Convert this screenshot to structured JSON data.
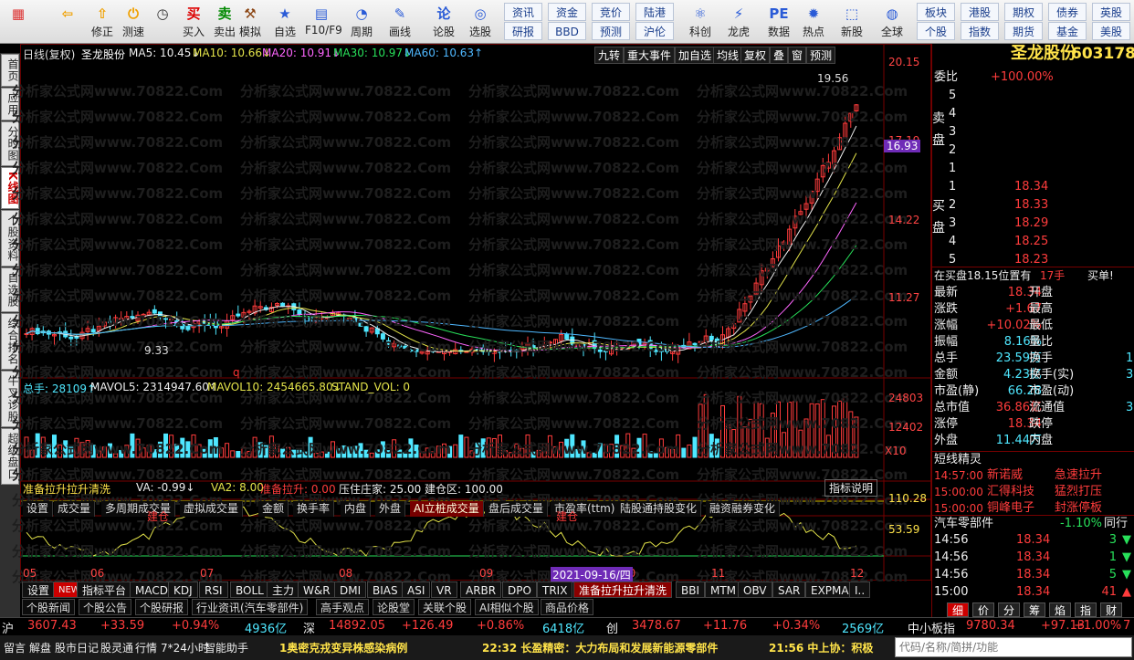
{
  "toolbar": {
    "buttons": [
      {
        "label": "",
        "icon": "apps-grid-icon",
        "c": "#d33"
      },
      {
        "label": "",
        "icon": "back-arrow-icon",
        "c": "#f0a000"
      },
      {
        "label": "修正",
        "icon": "arrow-up-icon",
        "c": "#f0a000"
      },
      {
        "label": "测速",
        "icon": "power-icon",
        "c": "#f0a000"
      },
      {
        "label": "",
        "icon": "clock-icon",
        "c": "#333"
      },
      {
        "label": "买入",
        "icon": "buy-icon",
        "c": "#d00"
      },
      {
        "label": "卖出",
        "icon": "sell-icon",
        "c": "#080"
      },
      {
        "label": "模拟",
        "icon": "hammer-icon",
        "c": "#8b4513"
      },
      {
        "label": "自选",
        "icon": "star-folder-icon",
        "c": "#2a5bd7"
      },
      {
        "label": "F10/F9",
        "icon": "f10-icon",
        "c": "#2a5bd7"
      },
      {
        "label": "周期",
        "icon": "cycle-icon",
        "c": "#2a5bd7"
      },
      {
        "label": "画线",
        "icon": "pencil-icon",
        "c": "#2a5bd7"
      },
      {
        "label": "论股",
        "icon": "discuss-icon",
        "c": "#2a5bd7"
      },
      {
        "label": "选股",
        "icon": "select-stock-icon",
        "c": "#2a5bd7"
      }
    ],
    "small": [
      "资讯",
      "资金",
      "竞价",
      "陆港",
      "研报",
      "BBD",
      "预测",
      "沪伦"
    ],
    "buttons2": [
      {
        "label": "科创",
        "icon": "kechuang-icon"
      },
      {
        "label": "龙虎",
        "icon": "longhu-icon"
      },
      {
        "label": "数据",
        "icon": "pe-icon"
      },
      {
        "label": "热点",
        "icon": "hot-icon"
      },
      {
        "label": "新股",
        "icon": "ipo-icon"
      },
      {
        "label": "全球",
        "icon": "globe-icon"
      }
    ],
    "small2": [
      "板块",
      "港股",
      "期权",
      "债券",
      "英股",
      "个股",
      "指数",
      "期货",
      "基金",
      "美股"
    ]
  },
  "left_tabs": [
    {
      "label": "首页",
      "on": false
    },
    {
      "label": "应用",
      "on": false
    },
    {
      "label": "分时图",
      "on": false
    },
    {
      "label": "K线图",
      "on": true
    },
    {
      "label": "个股资料",
      "on": false
    },
    {
      "label": "自选股",
      "on": false
    },
    {
      "label": "综合排名",
      "on": false
    },
    {
      "label": "牛叉诊股",
      "on": false
    },
    {
      "label": "超级盘口",
      "on": false
    }
  ],
  "kline": {
    "header": "日线(复权)",
    "name": "圣龙股份",
    "ma": [
      "MA5: 10.45↓",
      "MA10: 10.66↓",
      "MA20: 10.91↓",
      "MA30: 10.97↓",
      "MA60: 10.63↑"
    ],
    "buttons": [
      "九转",
      "重大事件",
      "加自选",
      "均线",
      "复权",
      "叠",
      "窗",
      "预测"
    ],
    "y_labels": [
      "20.15",
      "17.19",
      "14.22",
      "11.27"
    ],
    "current_price": "16.93",
    "high_label": "19.56",
    "low_label": "9.33",
    "marker": "q",
    "colors": {
      "up": "#ff3c3c",
      "down": "#4fe7ff",
      "ma5": "#eeeeee",
      "ma10": "#e4e44a",
      "ma20": "#ff66ff",
      "ma30": "#28e05a",
      "ma60": "#4fb8ff"
    }
  },
  "vol": {
    "title": "总手: 28109↑",
    "mavol5": "MAVOL5: 2314947.60↑",
    "mavol10": "MAVOL10: 2454665.80↓",
    "stand": "STAND_VOL: 0",
    "y_labels": [
      "24803",
      "12402"
    ],
    "unit": "X10"
  },
  "tabs1": [
    "设置",
    "成交量",
    "多周期成交量",
    "虚拟成交量",
    "金额",
    "换手率",
    "内盘",
    "外盘",
    "AI立桩成交量",
    "盘后成交量",
    "市盈率(ttm)",
    "陆股通持股变化",
    "融资融券变化"
  ],
  "ind": {
    "title": "准备拉升拉升清洗",
    "va": "VA: -0.99↓",
    "va2": "VA2: 8.00",
    "lasheng": "准备拉升: 0.00",
    "ya": "压住庄家: 25.00",
    "jian": "建仓区: 100.00",
    "help": "指标说明",
    "y_labels": [
      "110.28",
      "53.59"
    ],
    "jiancang": "建仓"
  },
  "x_axis": [
    "05",
    "06",
    "07",
    "08",
    "09",
    "10",
    "11",
    "12"
  ],
  "date_tag": "2021-09-16/四",
  "tabs2": [
    "设置",
    "NEW",
    "指标平台",
    "MACD",
    "KDJ",
    "RSI",
    "BOLL",
    "主力",
    "W&R",
    "DMI",
    "BIAS",
    "ASI",
    "VR",
    "ARBR",
    "DPO",
    "TRIX",
    "准备拉升拉升清洗",
    "BBI",
    "MTM",
    "OBV",
    "SAR",
    "EXPMA",
    "I.."
  ],
  "info_tabs": [
    "个股新闻",
    "个股公告",
    "个股研报",
    "行业资讯(汽车零部件)",
    "高手观点",
    "论股堂",
    "关联个股",
    "AI相似个股",
    "商品价格"
  ],
  "watermark": "分析家公式网www.70822.Com",
  "panel": {
    "title": "圣龙股份",
    "code": "603178",
    "weibi_label": "委比",
    "weibi": "+100.00%",
    "sell_label": "卖盘",
    "buy_label": "买盘",
    "asks": [
      {
        "n": "5",
        "p": "",
        "v": ""
      },
      {
        "n": "4",
        "p": "",
        "v": ""
      },
      {
        "n": "3",
        "p": "",
        "v": ""
      },
      {
        "n": "2",
        "p": "",
        "v": ""
      },
      {
        "n": "1",
        "p": "",
        "v": ""
      }
    ],
    "bids": [
      {
        "n": "1",
        "p": "18.34"
      },
      {
        "n": "2",
        "p": "18.33"
      },
      {
        "n": "3",
        "p": "18.29"
      },
      {
        "n": "4",
        "p": "18.25"
      },
      {
        "n": "5",
        "p": "18.23"
      }
    ],
    "note": "在买盘18.15位置有",
    "note_vol": "17手",
    "note_tag": "买单!",
    "quote": [
      [
        "最新",
        "18.34",
        "开盘",
        ""
      ],
      [
        "涨跌",
        "+1.67",
        "最高",
        ""
      ],
      [
        "涨幅",
        "+10.02%",
        "最低",
        ""
      ],
      [
        "振幅",
        "8.16%",
        "量比",
        ""
      ],
      [
        "总手",
        "23.59万",
        "换手",
        "1"
      ],
      [
        "金额",
        "4.23亿",
        "换手(实)",
        "3"
      ],
      [
        "市盈(静)",
        "66.28",
        "市盈(动)",
        ""
      ],
      [
        "总市值",
        "36.86亿",
        "流通值",
        "3"
      ],
      [
        "涨停",
        "18.34",
        "跌停",
        ""
      ],
      [
        "外盘",
        "11.44万",
        "内盘",
        ""
      ]
    ],
    "elves_title": "短线精灵",
    "elves": [
      [
        "14:57:00",
        "新诺威",
        "急速拉升"
      ],
      [
        "15:00:00",
        "汇得科技",
        "猛烈打压"
      ],
      [
        "15:00:00",
        "铜峰电子",
        "封涨停板"
      ]
    ],
    "sector": "汽车零部件",
    "sector_chg": "-1.10%",
    "sector_more": "同行",
    "ticks": [
      [
        "14:56",
        "18.34",
        "3",
        "down"
      ],
      [
        "14:56",
        "18.34",
        "1",
        "down"
      ],
      [
        "14:56",
        "18.34",
        "5",
        "down"
      ],
      [
        "15:00",
        "18.34",
        "41",
        "up"
      ]
    ],
    "bottom_tabs": [
      "细",
      "价",
      "分",
      "筹",
      "焰",
      "指",
      "财"
    ]
  },
  "status": [
    {
      "n": "沪",
      "v": "3607.43",
      "c": "+33.59",
      "p": "+0.94%",
      "a": "4936亿"
    },
    {
      "n": "深",
      "v": "14892.05",
      "c": "+126.49",
      "p": "+0.86%",
      "a": "6418亿"
    },
    {
      "n": "创",
      "v": "3478.67",
      "c": "+11.76",
      "p": "+0.34%",
      "a": "2569亿"
    },
    {
      "n": "中小板指",
      "v": "9780.34",
      "c": "+97.13",
      "p": "+1.00%",
      "a": "7"
    }
  ],
  "bottombar": {
    "items": [
      "留言",
      "解盘",
      "股市日记",
      "股灵通",
      "行情",
      "7*24小时",
      "智能助手"
    ],
    "news1": "1奥密克戎变异株感染病例",
    "news2": "22:32 长盈精密：大力布局和发展新能源零部件",
    "news3": "21:56 中上协：积极",
    "search_placeholder": "代码/名称/简拼/功能"
  }
}
